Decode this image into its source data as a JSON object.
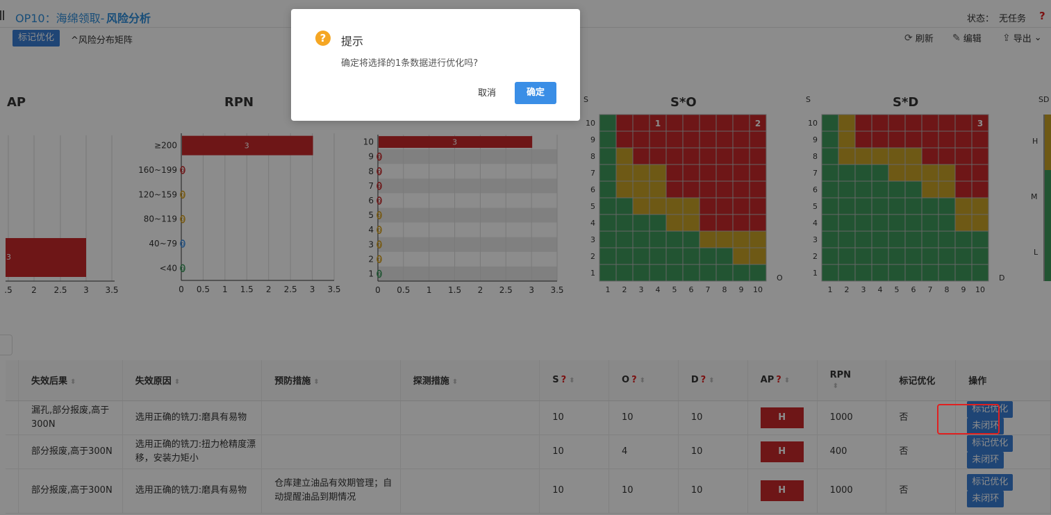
{
  "header": {
    "title_op": "OP10：海绵领取-",
    "title_main": "风险分析",
    "state_label": "状态：",
    "state_value": "无任务",
    "help": "?"
  },
  "toolbar": {
    "mark_button": "标记优化",
    "matrix_toggle": "风险分布矩阵",
    "refresh": "刷新",
    "edit": "编辑",
    "export": "导出"
  },
  "charts": {
    "ap": {
      "title": "AP",
      "bar_label": "3",
      "ticks": [
        ".5",
        "2",
        "2.5",
        "3",
        "3.5"
      ]
    },
    "rpn": {
      "title": "RPN",
      "categories": [
        "≥200",
        "160~199",
        "120~159",
        "80~119",
        "40~79",
        "<40"
      ],
      "values": [
        3,
        0,
        0,
        0,
        0,
        0
      ],
      "marker_colors": [
        "#c8282b",
        "#c8282b",
        "#d9a019",
        "#d9a019",
        "#3a8ee6",
        "#3a9a5c"
      ],
      "x_ticks": [
        "0",
        "0.5",
        "1",
        "1.5",
        "2",
        "2.5",
        "3",
        "3.5"
      ]
    },
    "s": {
      "title": "S",
      "categories": [
        "10",
        "9",
        "8",
        "7",
        "6",
        "5",
        "4",
        "3",
        "2",
        "1"
      ],
      "values": [
        3,
        0,
        0,
        0,
        0,
        0,
        0,
        0,
        0,
        0
      ],
      "marker_colors": [
        "#c8282b",
        "#c8282b",
        "#c8282b",
        "#c8282b",
        "#c8282b",
        "#d9a019",
        "#d9a019",
        "#d9a019",
        "#d9a019",
        "#3a9a5c"
      ],
      "x_ticks": [
        "0",
        "0.5",
        "1",
        "1.5",
        "2",
        "2.5",
        "3",
        "3.5"
      ]
    },
    "so": {
      "title": "S*O",
      "y_axis": "S",
      "x_axis": "O",
      "counts": [
        {
          "s": 10,
          "o": 4,
          "label": "1"
        },
        {
          "s": 10,
          "o": 10,
          "label": "2"
        }
      ]
    },
    "sd": {
      "title": "S*D",
      "y_axis": "S",
      "x_axis": "D",
      "counts": [
        {
          "s": 10,
          "d": 10,
          "label": "3"
        }
      ]
    },
    "sod": {
      "title": "SD",
      "levels": [
        "H",
        "M",
        "L"
      ]
    }
  },
  "colors": {
    "red": "#c8282b",
    "yellow": "#c9a227",
    "green": "#3f9a5c",
    "accent": "#3a7fd5"
  },
  "table": {
    "headers": [
      "失效后果",
      "失效原因",
      "预防措施",
      "探测措施",
      "S",
      "O",
      "D",
      "AP",
      "RPN",
      "标记优化",
      "操作"
    ],
    "rows": [
      {
        "effect": "漏孔,部分报废,高于300N",
        "cause": "选用正确的铣刀:磨具有易物",
        "prevent": "",
        "detect": "",
        "s": "10",
        "o": "10",
        "d": "10",
        "ap": "H",
        "rpn": "1000",
        "mark": "否"
      },
      {
        "effect": "部分报废,高于300N",
        "cause": "选用正确的铣刀:扭力枪精度漂移，安装力矩小",
        "prevent": "",
        "detect": "",
        "s": "10",
        "o": "4",
        "d": "10",
        "ap": "H",
        "rpn": "400",
        "mark": "否"
      },
      {
        "effect": "部分报废,高于300N",
        "cause": "选用正确的铣刀:磨具有易物",
        "prevent": "仓库建立油品有效期管理；自动提醒油品到期情况",
        "detect": "",
        "s": "10",
        "o": "10",
        "d": "10",
        "ap": "H",
        "rpn": "1000",
        "mark": "否"
      }
    ],
    "op_mark": "标记优化",
    "op_close": "未闭环"
  },
  "dialog": {
    "title": "提示",
    "message": "确定将选择的1条数据进行优化吗?",
    "cancel": "取消",
    "ok": "确定"
  }
}
